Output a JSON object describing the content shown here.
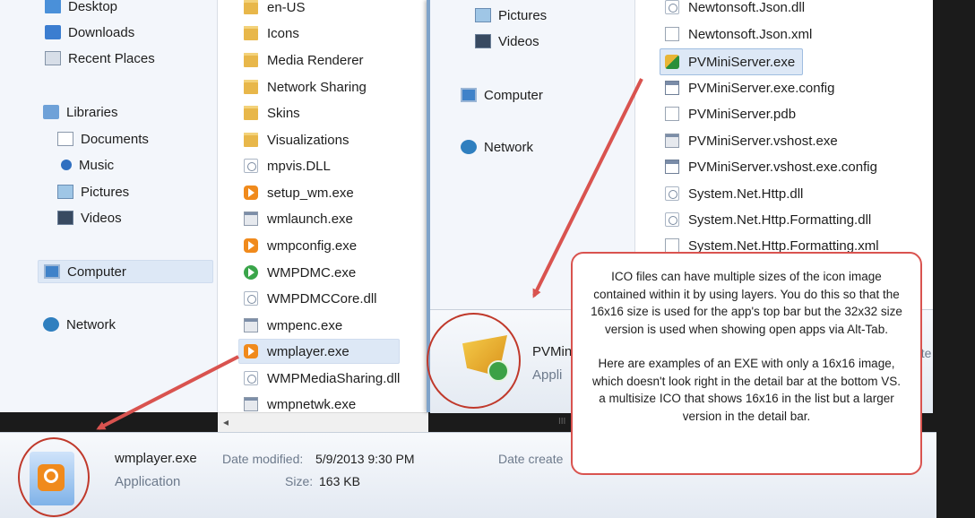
{
  "left_window": {
    "nav": [
      {
        "label": "Desktop",
        "icon": "desktop-icon"
      },
      {
        "label": "Downloads",
        "icon": "downloads-icon"
      },
      {
        "label": "Recent Places",
        "icon": "recent-places-icon"
      },
      {
        "label": "Libraries",
        "icon": "libraries-icon"
      },
      {
        "label": "Documents",
        "icon": "documents-icon"
      },
      {
        "label": "Music",
        "icon": "music-icon"
      },
      {
        "label": "Pictures",
        "icon": "pictures-icon"
      },
      {
        "label": "Videos",
        "icon": "videos-icon"
      },
      {
        "label": "Computer",
        "icon": "computer-icon"
      },
      {
        "label": "Network",
        "icon": "network-icon"
      }
    ],
    "files": [
      {
        "name": "en-US",
        "icon": "folder-icon"
      },
      {
        "name": "Icons",
        "icon": "folder-icon"
      },
      {
        "name": "Media Renderer",
        "icon": "folder-icon"
      },
      {
        "name": "Network Sharing",
        "icon": "folder-icon"
      },
      {
        "name": "Skins",
        "icon": "folder-icon"
      },
      {
        "name": "Visualizations",
        "icon": "folder-icon"
      },
      {
        "name": "mpvis.DLL",
        "icon": "dll-file-icon"
      },
      {
        "name": "setup_wm.exe",
        "icon": "media-player-icon"
      },
      {
        "name": "wmlaunch.exe",
        "icon": "exe-file-icon"
      },
      {
        "name": "wmpconfig.exe",
        "icon": "media-player-icon"
      },
      {
        "name": "WMPDMC.exe",
        "icon": "dmc-icon"
      },
      {
        "name": "WMPDMCCore.dll",
        "icon": "dll-file-icon"
      },
      {
        "name": "wmpenc.exe",
        "icon": "exe-file-icon"
      },
      {
        "name": "wmplayer.exe",
        "icon": "media-player-icon"
      },
      {
        "name": "WMPMediaSharing.dll",
        "icon": "dll-file-icon"
      },
      {
        "name": "wmpnetwk.exe",
        "icon": "exe-file-icon"
      }
    ],
    "scroll_glyph_left": "◂",
    "scroll_glyph_mid": "III",
    "details": {
      "name": "wmplayer.exe",
      "type": "Application",
      "modified_label": "Date modified:",
      "modified_value": "5/9/2013 9:30 PM",
      "size_label": "Size:",
      "size_value": "163 KB",
      "created_label": "Date create"
    }
  },
  "right_window": {
    "nav": [
      {
        "label": "Pictures",
        "icon": "pictures-icon"
      },
      {
        "label": "Videos",
        "icon": "videos-icon"
      },
      {
        "label": "Computer",
        "icon": "computer-icon"
      },
      {
        "label": "Network",
        "icon": "network-icon"
      }
    ],
    "files": [
      {
        "name": "Newtonsoft.Json.dll",
        "icon": "dll-file-icon"
      },
      {
        "name": "Newtonsoft.Json.xml",
        "icon": "xml-file-icon"
      },
      {
        "name": "PVMiniServer.exe",
        "icon": "pvminiserver-icon"
      },
      {
        "name": "PVMiniServer.exe.config",
        "icon": "config-file-icon"
      },
      {
        "name": "PVMiniServer.pdb",
        "icon": "document-icon"
      },
      {
        "name": "PVMiniServer.vshost.exe",
        "icon": "exe-file-icon"
      },
      {
        "name": "PVMiniServer.vshost.exe.config",
        "icon": "config-file-icon"
      },
      {
        "name": "System.Net.Http.dll",
        "icon": "dll-file-icon"
      },
      {
        "name": "System.Net.Http.Formatting.dll",
        "icon": "dll-file-icon"
      },
      {
        "name": "System.Net.Http.Formatting.xml",
        "icon": "xml-file-icon"
      }
    ],
    "details": {
      "name": "PVMini",
      "type": "Appli",
      "trailing": "ate"
    }
  },
  "callout": {
    "paragraph1": "ICO files can have multiple sizes of the icon image contained within it by using layers.  You do this so that the 16x16 size is used for the app's top bar but the 32x32 size version is used when showing open apps via Alt-Tab.",
    "paragraph2": "Here are examples of an EXE with only a 16x16 image, which doesn't look right in the detail bar at the bottom VS. a multisize ICO that shows 16x16 in the list but a larger version in the detail bar."
  },
  "colors": {
    "annotation_red": "#d9534f",
    "selection_blue": "#dde8f6",
    "window_border": "#7fa3c9"
  }
}
